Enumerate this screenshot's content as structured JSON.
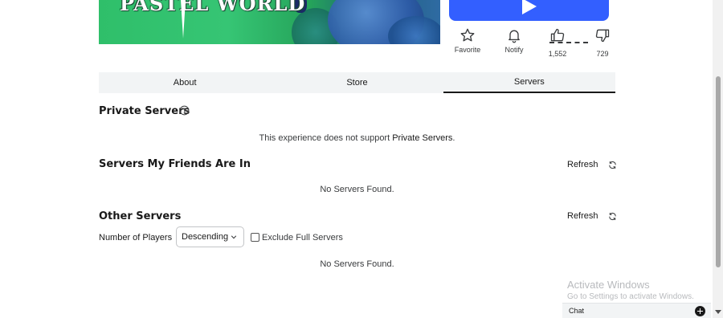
{
  "game": {
    "thumbnail_title": "PASTEL WORLD"
  },
  "actions": {
    "favorite": "Favorite",
    "notify": "Notify",
    "upvotes": "1,552",
    "downvotes": "729"
  },
  "tabs": [
    {
      "label": "About",
      "active": false
    },
    {
      "label": "Store",
      "active": false
    },
    {
      "label": "Servers",
      "active": true
    }
  ],
  "private_servers": {
    "title": "Private Servers",
    "message_prefix": "This experience does not support ",
    "message_link": "Private Servers",
    "message_suffix": "."
  },
  "friends_servers": {
    "title": "Servers My Friends Are In",
    "refresh_label": "Refresh",
    "empty_message": "No Servers Found."
  },
  "other_servers": {
    "title": "Other Servers",
    "refresh_label": "Refresh",
    "filter_label": "Number of Players",
    "sort_value": "Descending",
    "exclude_full_label": "Exclude Full Servers",
    "exclude_full_checked": false,
    "empty_message": "No Servers Found."
  },
  "watermark": {
    "title": "Activate Windows",
    "subtitle": "Go to Settings to activate Windows."
  },
  "chat": {
    "label": "Chat"
  },
  "colors": {
    "play_button": "#335fff",
    "text_primary": "#191919",
    "tab_background": "#f2f4f5"
  }
}
